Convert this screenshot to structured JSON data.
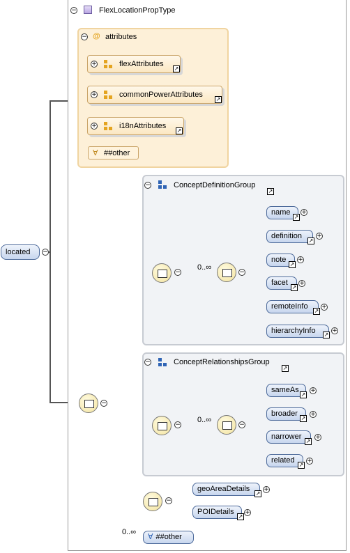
{
  "type_name": "FlexLocationPropType",
  "root_element": "located",
  "attributes": {
    "label": "attributes",
    "groups": [
      "flexAttributes",
      "commonPowerAttributes",
      "i18nAttributes"
    ],
    "any_attribute": "##other"
  },
  "concept_definition_group": {
    "label": "ConceptDefinitionGroup",
    "cardinality": "0..∞",
    "items": [
      "name",
      "definition",
      "note",
      "facet",
      "remoteInfo",
      "hierarchyInfo"
    ]
  },
  "concept_relationships_group": {
    "label": "ConceptRelationshipsGroup",
    "cardinality": "0..∞",
    "items": [
      "sameAs",
      "broader",
      "narrower",
      "related"
    ]
  },
  "choice_items": [
    "geoAreaDetails",
    "POIDetails"
  ],
  "any_element": {
    "label": "##other",
    "cardinality": "0..∞"
  },
  "colors": {
    "element_fill": "#c7d6ee",
    "element_border": "#4d6a9a",
    "attribute_box": "#fdf0d8",
    "group_box": "#f1f3f6",
    "compositor_fill": "#f3e3a0"
  }
}
